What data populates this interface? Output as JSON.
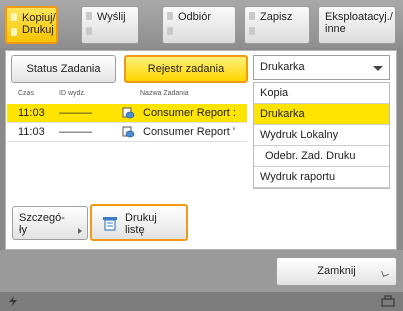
{
  "tabs": [
    {
      "line1": "Kopiuj/",
      "line2": "Drukuj"
    },
    {
      "line1": "Wyślij",
      "line2": ""
    },
    {
      "line1": "Odbiór",
      "line2": ""
    },
    {
      "line1": "Zapisz",
      "line2": ""
    },
    {
      "line1": "Eksploatacyj./",
      "line2": "inne"
    }
  ],
  "subtabs": {
    "status": "Status Zadania",
    "log": "Rejestr zadania"
  },
  "dropdown": {
    "selected": "Drukarka",
    "options": [
      "Kopia",
      "Drukarka",
      "Wydruk Lokalny",
      "Odebr. Zad. Druku",
      "Wydruk raportu"
    ]
  },
  "columns": {
    "time": "Czas",
    "id": "ID wydz.",
    "name": "Nazwa Zadania"
  },
  "rows": [
    {
      "time": "11:03",
      "id": "———",
      "name": "Consumer Report :"
    },
    {
      "time": "11:03",
      "id": "———",
      "name": "Consumer Report '"
    }
  ],
  "buttons": {
    "details_l1": "Szczegó-",
    "details_l2": "ły",
    "print_l1": "Drukuj",
    "print_l2": "listę",
    "close": "Zamknij"
  }
}
